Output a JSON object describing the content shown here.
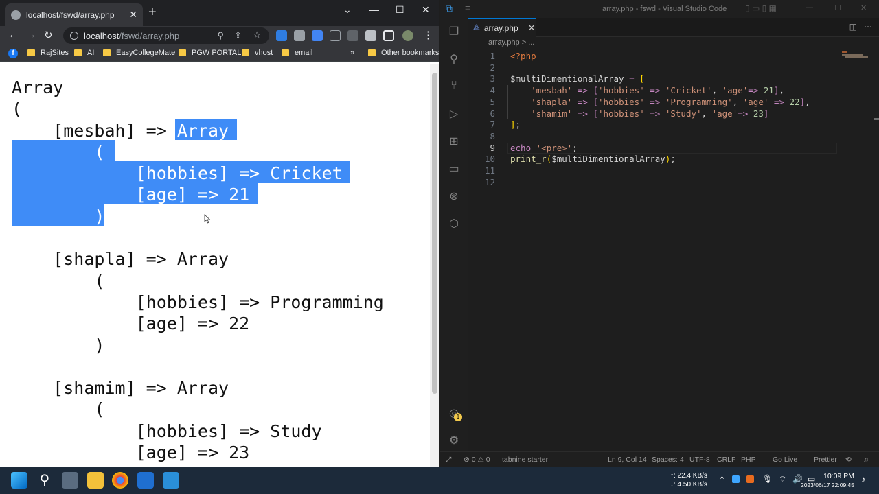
{
  "browser": {
    "tab_title": "localhost/fswd/array.php",
    "tab_close": "✕",
    "new_tab": "+",
    "window_min": "—",
    "window_max": "☐",
    "window_close": "✕",
    "url_host": "localhost",
    "url_path": "/fswd/array.php",
    "back": "←",
    "forward": "→",
    "reload": "↻",
    "bookmarks": [
      "RajSites",
      "AI",
      "EasyCollegeMate",
      "PGW PORTAL",
      "vhost",
      "email"
    ],
    "bookmarks_more": "»",
    "other_bookmarks": "Other bookmarks",
    "facebook_letter": "f"
  },
  "page": {
    "lines": [
      {
        "text": "Array"
      },
      {
        "text": "("
      },
      {
        "text": "    [mesbah] => ",
        "hl": "Array "
      },
      {
        "text": "",
        "hl": "        ("
      },
      {
        "text": "",
        "hl": "            [hobbies] => Cricket"
      },
      {
        "text": "",
        "hl": "            [age] => 21"
      },
      {
        "text": "",
        "hl": "        )"
      },
      {
        "text": ""
      },
      {
        "text": "    [shapla] => Array"
      },
      {
        "text": "        ("
      },
      {
        "text": "            [hobbies] => Programming"
      },
      {
        "text": "            [age] => 22"
      },
      {
        "text": "        )"
      },
      {
        "text": ""
      },
      {
        "text": "    [shamim] => Array"
      },
      {
        "text": "        ("
      },
      {
        "text": "            [hobbies] => Study"
      },
      {
        "text": "            [age] => 23"
      }
    ]
  },
  "vscode": {
    "window_title": "array.php - fswd - Visual Studio Code",
    "tab_label": "array.php",
    "tab_icon": "⟁",
    "tab_close": "✕",
    "breadcrumb": "array.php > ...",
    "code_lines": [
      {
        "n": "1",
        "html": "<span class='php'>&lt;?php</span>"
      },
      {
        "n": "2",
        "html": ""
      },
      {
        "n": "3",
        "html": "<span class='var'>$multiDimentionalArray</span> <span class='op'>=</span> <span class='br'>[</span>"
      },
      {
        "n": "4",
        "html": "    <span class='str'>'mesbah'</span> <span class='op'>=&gt;</span> <span class='kw'>[</span><span class='str'>'hobbies'</span> <span class='op'>=&gt;</span> <span class='str'>'Cricket'</span><span class='pl'>,</span> <span class='str'>'age'</span><span class='op'>=&gt;</span> <span class='numc'>21</span><span class='kw'>]</span><span class='pl'>,</span>"
      },
      {
        "n": "5",
        "html": "    <span class='str'>'shapla'</span> <span class='op'>=&gt;</span> <span class='kw'>[</span><span class='str'>'hobbies'</span> <span class='op'>=&gt;</span> <span class='str'>'Programming'</span><span class='pl'>,</span> <span class='str'>'age'</span> <span class='op'>=&gt;</span> <span class='numc'>22</span><span class='kw'>]</span><span class='pl'>,</span>"
      },
      {
        "n": "6",
        "html": "    <span class='str'>'shamim'</span> <span class='op'>=&gt;</span> <span class='kw'>[</span><span class='str'>'hobbies'</span> <span class='op'>=&gt;</span> <span class='str'>'Study'</span><span class='pl'>,</span> <span class='str'>'age'</span><span class='op'>=&gt;</span> <span class='numc'>23</span><span class='kw'>]</span>"
      },
      {
        "n": "7",
        "html": "<span class='br'>]</span><span class='pl'>;</span>"
      },
      {
        "n": "8",
        "html": ""
      },
      {
        "n": "9",
        "html": "<span class='kw'>echo</span> <span class='str'>'&lt;pre&gt;'</span><span class='pl'>;</span>"
      },
      {
        "n": "10",
        "html": "<span class='fn'>print_r</span><span class='br'>(</span><span class='var'>$multiDimentionalArray</span><span class='br'>)</span><span class='pl'>;</span>"
      },
      {
        "n": "11",
        "html": ""
      },
      {
        "n": "12",
        "html": ""
      }
    ],
    "current_line": "9",
    "status": {
      "errors": "⊗ 0 ⚠ 0",
      "tabnine": "tabnine starter",
      "position": "Ln 9, Col 14",
      "spaces": "Spaces: 4",
      "encoding": "UTF-8",
      "eol": "CRLF",
      "language": "PHP",
      "golive": "Go Live",
      "prettier": "Prettier",
      "account_badge": "1"
    }
  },
  "taskbar": {
    "net_up": "↑: 22.4 KB/s",
    "net_down": "↓: 4.50 KB/s",
    "time": "10:09 PM",
    "date": "2023/06/17 22:09:45"
  },
  "colors": {
    "selection": "#3f8cf7",
    "vscode_accent": "#0078d4"
  }
}
